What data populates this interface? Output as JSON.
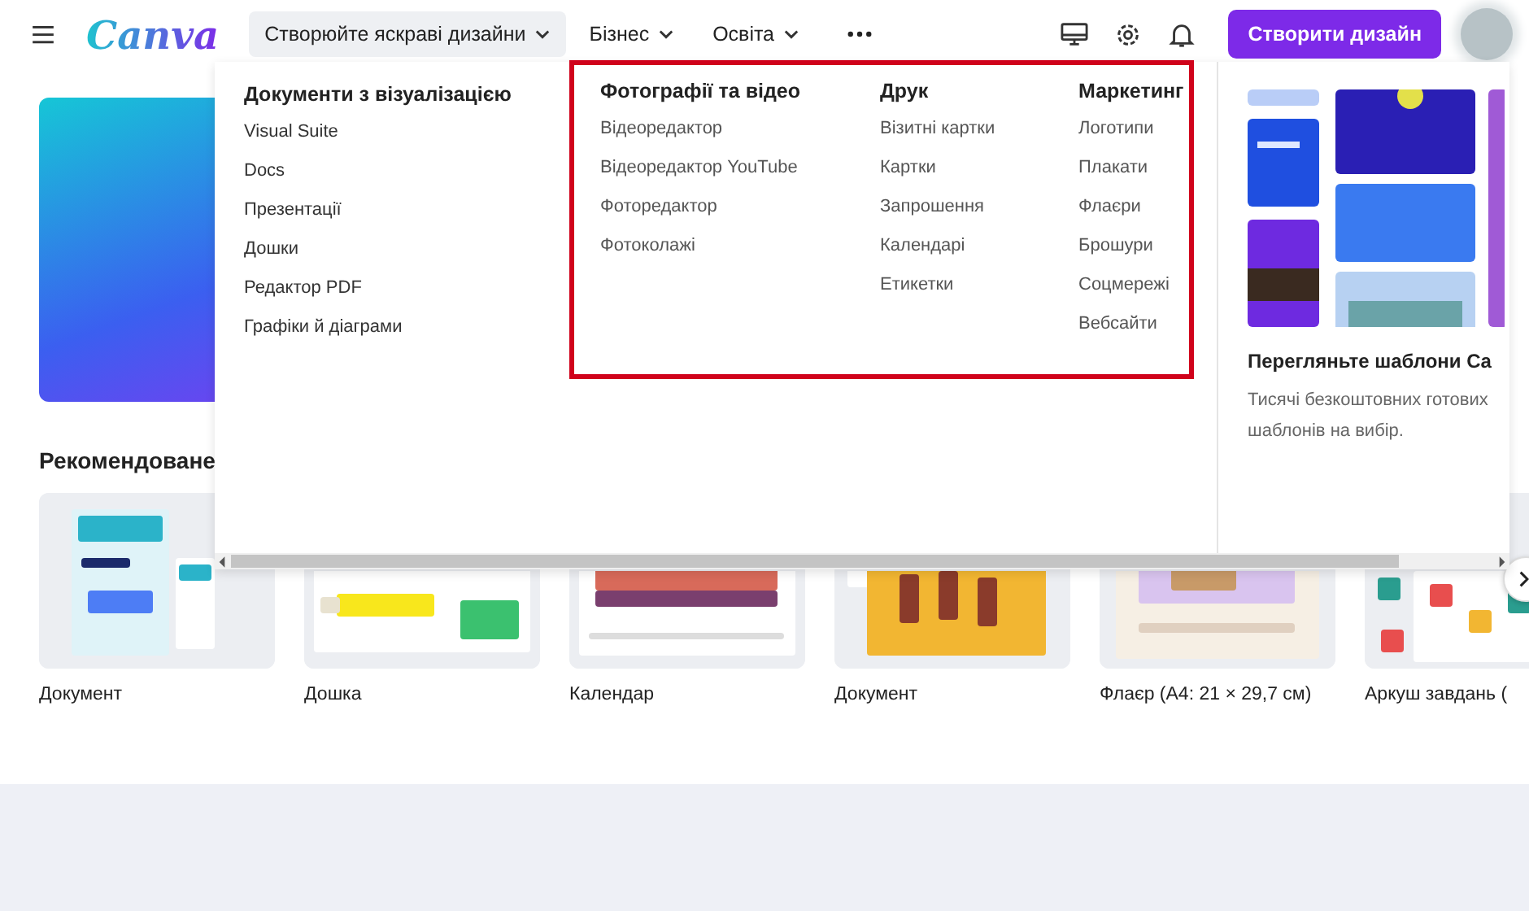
{
  "header": {
    "logo": "Canva",
    "nav": [
      {
        "label": "Створюйте яскраві дизайни",
        "selected": true,
        "dropdown": true
      },
      {
        "label": "Бізнес",
        "selected": false,
        "dropdown": true
      },
      {
        "label": "Освіта",
        "selected": false,
        "dropdown": true
      }
    ],
    "create_button": "Створити дизайн"
  },
  "menu": {
    "sections": [
      {
        "highlighted": false,
        "columns": [
          {
            "title": "Документи з візуалізацією",
            "items": [
              "Visual Suite",
              "Docs",
              "Презентації",
              "Дошки",
              "Редактор PDF",
              "Графіки й діаграми"
            ]
          }
        ]
      },
      {
        "highlighted": true,
        "columns": [
          {
            "title": "Фотографії та відео",
            "items": [
              "Відеоредактор",
              "Відеоредактор YouTube",
              "Фоторедактор",
              "Фотоколажі"
            ]
          },
          {
            "title": "Друк",
            "items": [
              "Візитні картки",
              "Картки",
              "Запрошення",
              "Календарі",
              "Етикетки"
            ]
          },
          {
            "title": "Маркетинг",
            "items": [
              "Логотипи",
              "Плакати",
              "Флаєри",
              "Брошури",
              "Соцмережі",
              "Вебсайти"
            ]
          }
        ]
      }
    ],
    "promo": {
      "title": "Перегляньте шаблони Ca",
      "text": "Тисячі безкоштовних готових шаблонів на вибір."
    }
  },
  "recommended": {
    "title": "Рекомендоване",
    "cards": [
      {
        "label": "Документ"
      },
      {
        "label": "Дошка"
      },
      {
        "label": "Календар"
      },
      {
        "label": "Документ"
      },
      {
        "label": "Флаєр (A4: 21 × 29,7 см)"
      },
      {
        "label": "Аркуш завдань ("
      }
    ]
  }
}
